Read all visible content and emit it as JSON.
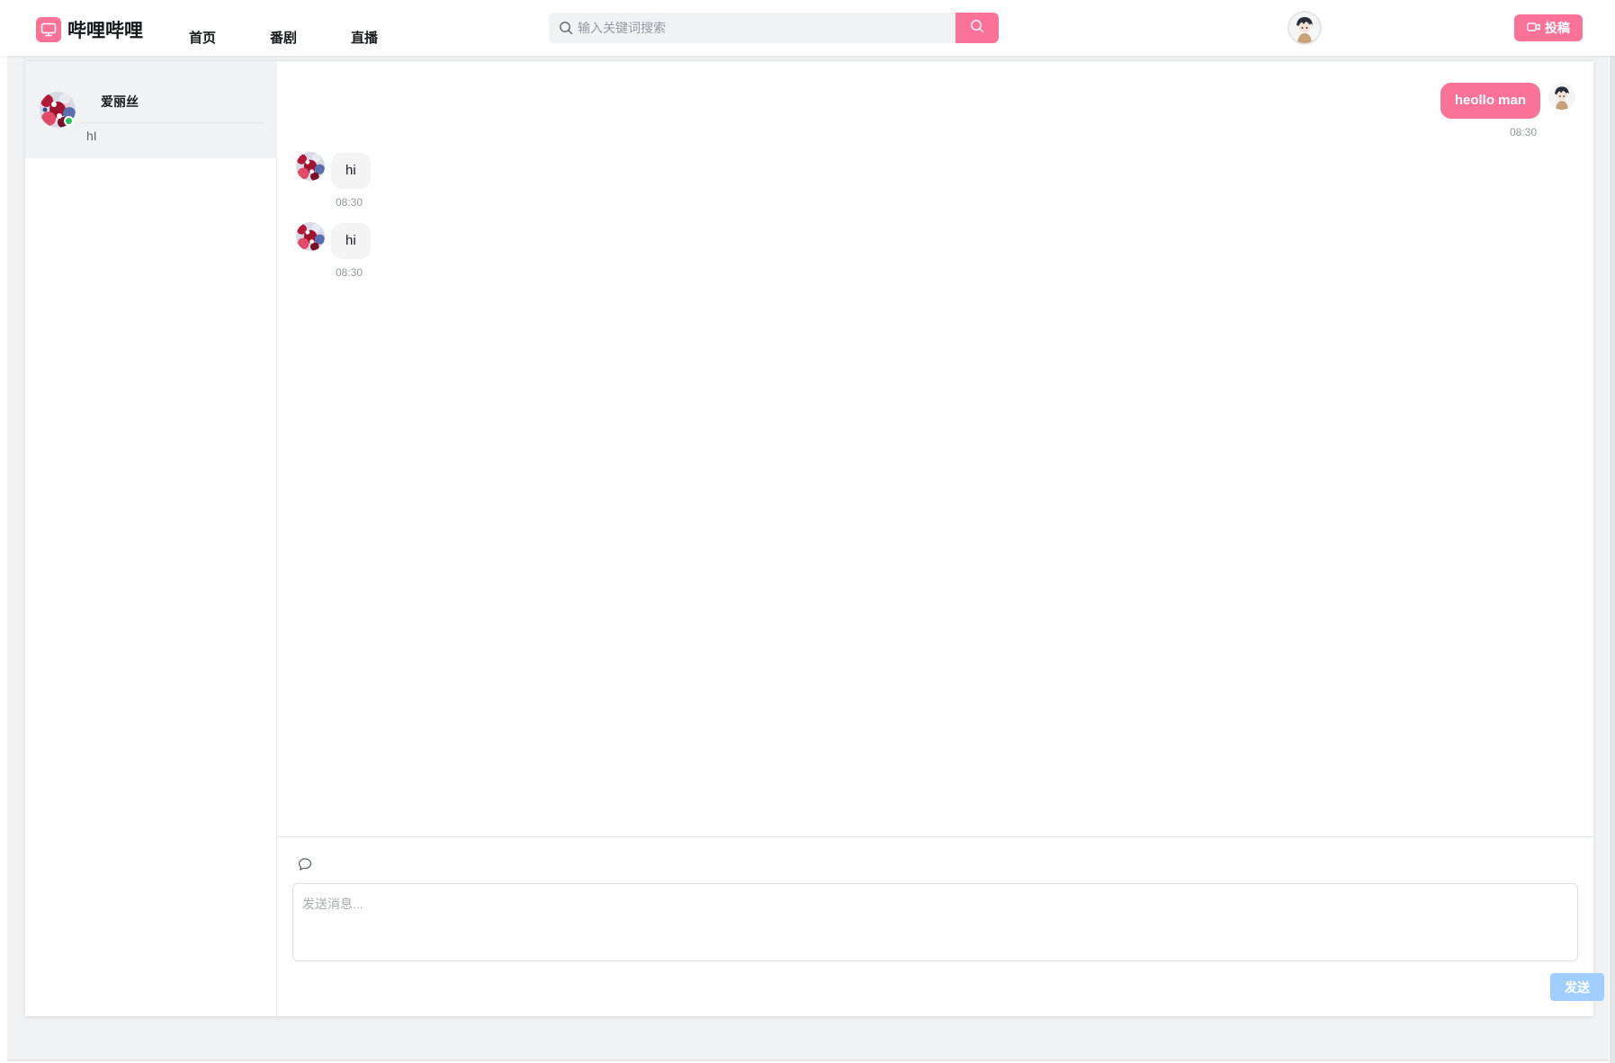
{
  "header": {
    "logo_text": "哔哩哔哩",
    "nav": [
      "首页",
      "番剧",
      "直播"
    ],
    "search_placeholder": "输入关键词搜索",
    "upload_label": "投稿",
    "brand_color": "#fb7299"
  },
  "sidebar": {
    "contacts": [
      {
        "name": "爱丽丝",
        "last_message": "hI",
        "online": true
      }
    ]
  },
  "chat": {
    "messages": [
      {
        "from": "me",
        "text": "heollo man",
        "time": "08:30"
      },
      {
        "from": "爱丽丝",
        "text": "hi",
        "time": "08:30"
      },
      {
        "from": "爱丽丝",
        "text": "hi",
        "time": "08:30"
      }
    ]
  },
  "composer": {
    "placeholder": "发送消息...",
    "send_label": "发送"
  }
}
